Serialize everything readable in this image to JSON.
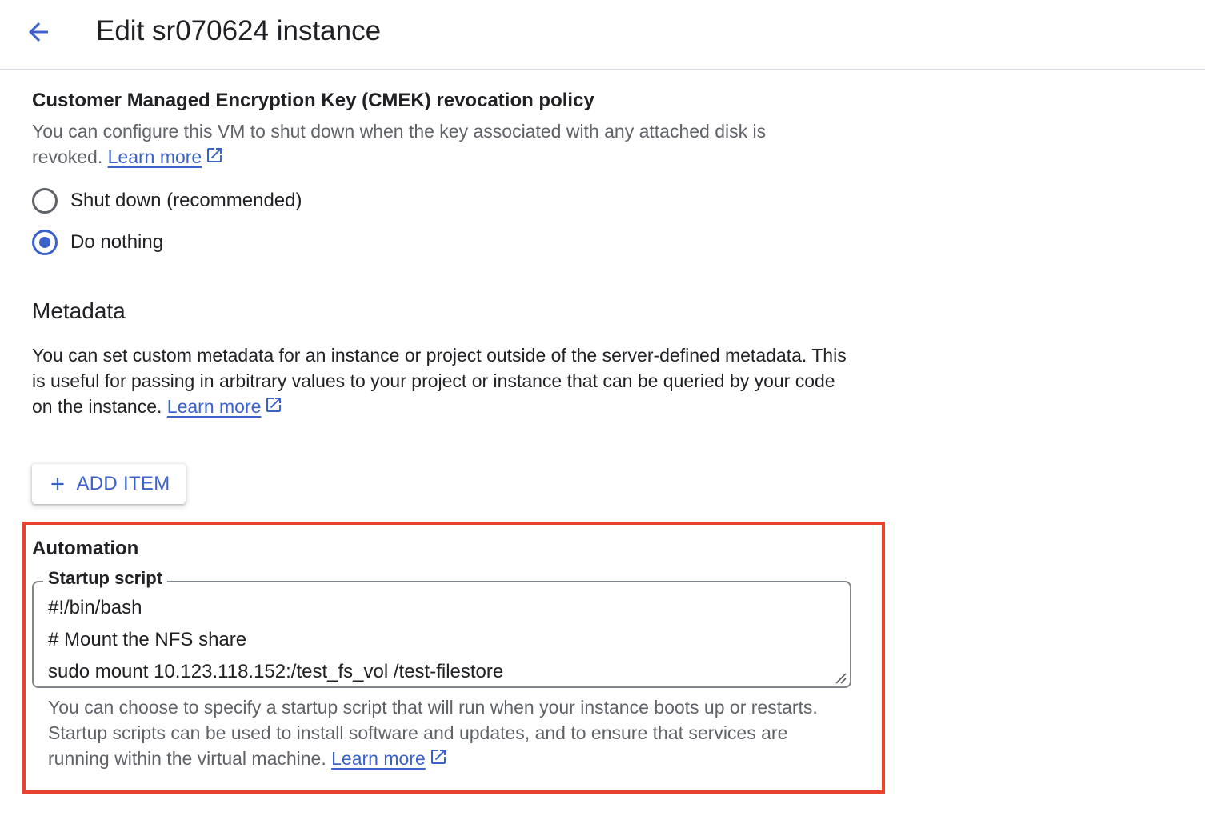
{
  "header": {
    "back_icon": "arrow-left-icon",
    "title": "Edit sr070624 instance"
  },
  "cmek": {
    "title": "Customer Managed Encryption Key (CMEK) revocation policy",
    "description": "You can configure this VM to shut down when the key associated with any attached disk is revoked.",
    "learn_more": "Learn more",
    "options": [
      {
        "label": "Shut down (recommended)",
        "selected": false
      },
      {
        "label": "Do nothing",
        "selected": true
      }
    ]
  },
  "metadata": {
    "title": "Metadata",
    "description": "You can set custom metadata for an instance or project outside of the server-defined metadata. This is useful for passing in arbitrary values to your project or instance that can be queried by your code on the instance.",
    "learn_more": "Learn more",
    "add_button": "ADD ITEM"
  },
  "automation": {
    "title": "Automation",
    "startup_script_label": "Startup script",
    "script_lines": [
      "#!/bin/bash",
      "# Mount the NFS share",
      "sudo mount 10.123.118.152:/test_fs_vol /test-filestore"
    ],
    "helper": "You can choose to specify a startup script that will run when your instance boots up or restarts. Startup scripts can be used to install software and updates, and to ensure that services are running within the virtual machine.",
    "learn_more": "Learn more"
  },
  "colors": {
    "accent": "#3b62c9",
    "highlight": "#e8432f",
    "text": "#202124",
    "muted": "#5f6368"
  }
}
